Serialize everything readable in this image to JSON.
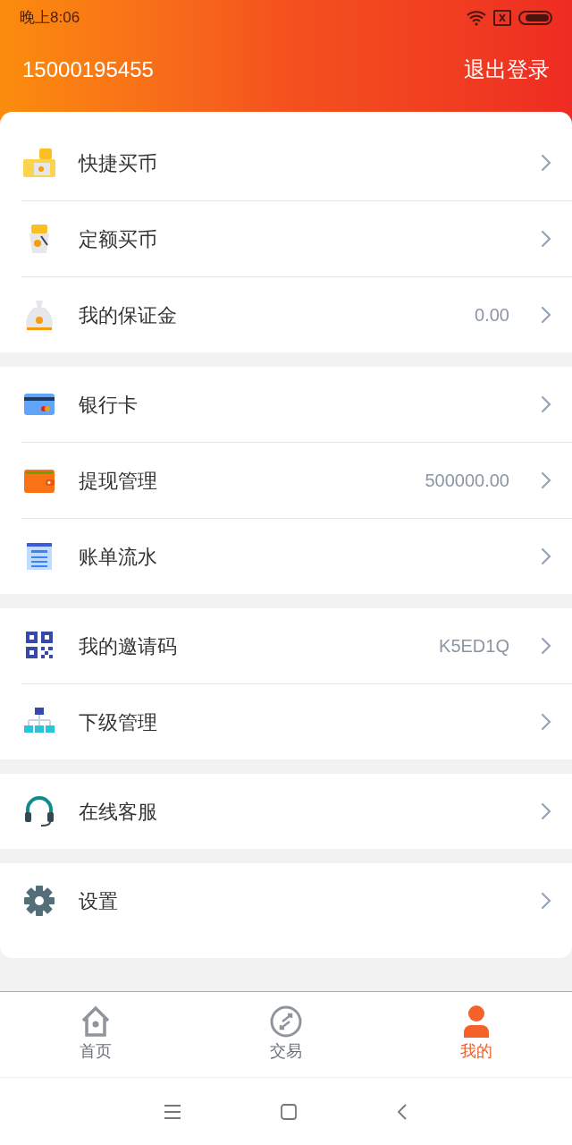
{
  "status_bar": {
    "time": "晚上8:06"
  },
  "header": {
    "account": "15000195455",
    "logout": "退出登录"
  },
  "groups": [
    {
      "items": [
        {
          "label": "快捷买币"
        },
        {
          "label": "定额买币"
        },
        {
          "label": "我的保证金",
          "value": "0.00"
        }
      ]
    },
    {
      "items": [
        {
          "label": "银行卡"
        },
        {
          "label": "提现管理",
          "value": "500000.00"
        },
        {
          "label": "账单流水"
        }
      ]
    },
    {
      "items": [
        {
          "label": "我的邀请码",
          "value": "K5ED1Q"
        },
        {
          "label": "下级管理"
        }
      ]
    },
    {
      "items": [
        {
          "label": "在线客服"
        }
      ]
    },
    {
      "items": [
        {
          "label": "设置"
        }
      ]
    }
  ],
  "tab_bar": [
    {
      "label": "首页",
      "selected": false
    },
    {
      "label": "交易",
      "selected": false
    },
    {
      "label": "我的",
      "selected": true
    }
  ]
}
